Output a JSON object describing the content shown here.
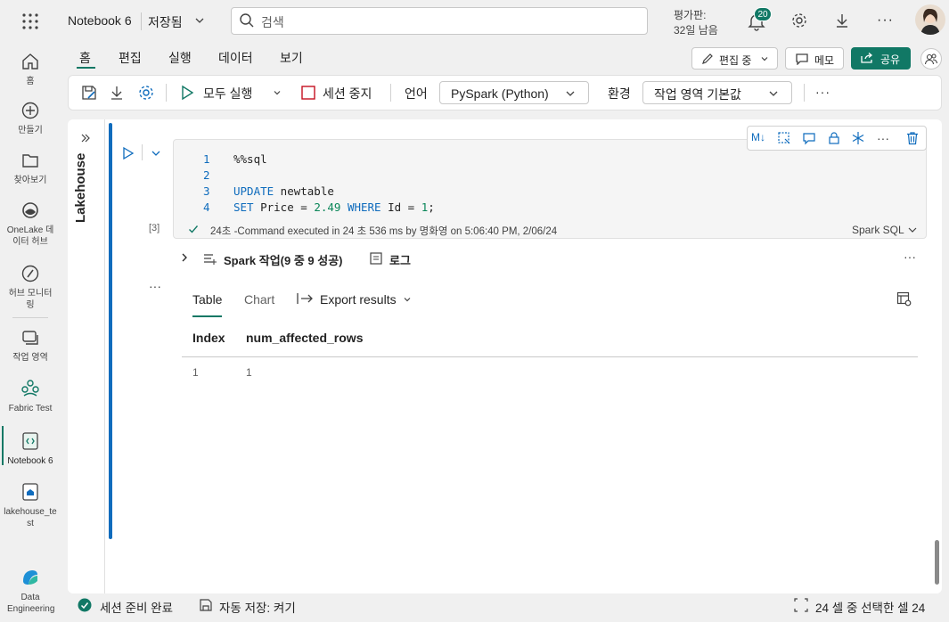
{
  "topbar": {
    "notebook_title": "Notebook 6",
    "save_state": "저장됨",
    "search_placeholder": "검색",
    "trial_line1": "평가판:",
    "trial_line2": "32일 남음",
    "notification_count": "20",
    "more": "···"
  },
  "rail": {
    "items": [
      {
        "label": "홈",
        "icon": "home-icon"
      },
      {
        "label": "만들기",
        "icon": "create-icon"
      },
      {
        "label": "찾아보기",
        "icon": "browse-icon"
      },
      {
        "label": "OneLake 데이터 허브",
        "icon": "onelake-icon"
      },
      {
        "label": "허브 모니터링",
        "icon": "monitor-icon"
      },
      {
        "label": "작업 영역",
        "icon": "workspace-icon"
      },
      {
        "label": "Fabric Test",
        "icon": "fabric-test-icon"
      },
      {
        "label": "Notebook 6",
        "icon": "notebook-icon"
      },
      {
        "label": "lakehouse_test",
        "icon": "lakehouse-icon"
      },
      {
        "label": "Data Engineering",
        "icon": "data-engineering-icon"
      }
    ]
  },
  "ribbon": {
    "tabs": [
      "홈",
      "편집",
      "실행",
      "데이터",
      "보기"
    ],
    "edit_mode": "편집 중",
    "memo": "메모",
    "share": "공유",
    "run_all": "모두 실행",
    "stop_session": "세션 중지",
    "language_label": "언어",
    "language_value": "PySpark (Python)",
    "env_label": "환경",
    "env_value": "작업 영역 기본값",
    "more": "···"
  },
  "lakehouse_panel": {
    "label": "Lakehouse"
  },
  "cell": {
    "line_numbers": [
      "1",
      "2",
      "3",
      "4"
    ],
    "code_line1": "%%sql",
    "code_line3_kw": "UPDATE",
    "code_line3_rest": " newtable",
    "code_line4_kw1": "SET",
    "code_line4_mid": " Price = ",
    "code_line4_num": "2.49",
    "code_line4_kw2": " WHERE",
    "code_line4_mid2": " Id = ",
    "code_line4_num2": "1",
    "code_line4_end": ";",
    "exec_count": "[3]",
    "status": "24초 -Command executed in 24 초 536 ms by 명화영 on 5:06:40 PM, 2/06/24",
    "cell_language": "Spark SQL",
    "toolbar_markdown": "M↓",
    "spark_jobs": "Spark 작업(9 중 9 성공)",
    "log": "로그",
    "more": "···"
  },
  "output": {
    "tabs": [
      "Table",
      "Chart"
    ],
    "export": "Export results",
    "columns": [
      "Index",
      "num_affected_rows"
    ],
    "rows": [
      [
        "1",
        "1"
      ]
    ]
  },
  "statusbar": {
    "session_ready": "세션 준비 완료",
    "autosave": "자동 저장: 켜기",
    "selection": "24 셀 중 선택한 셀 24"
  },
  "colors": {
    "accent": "#117865",
    "code_blue": "#0f6cbd",
    "number_green": "#098658"
  }
}
